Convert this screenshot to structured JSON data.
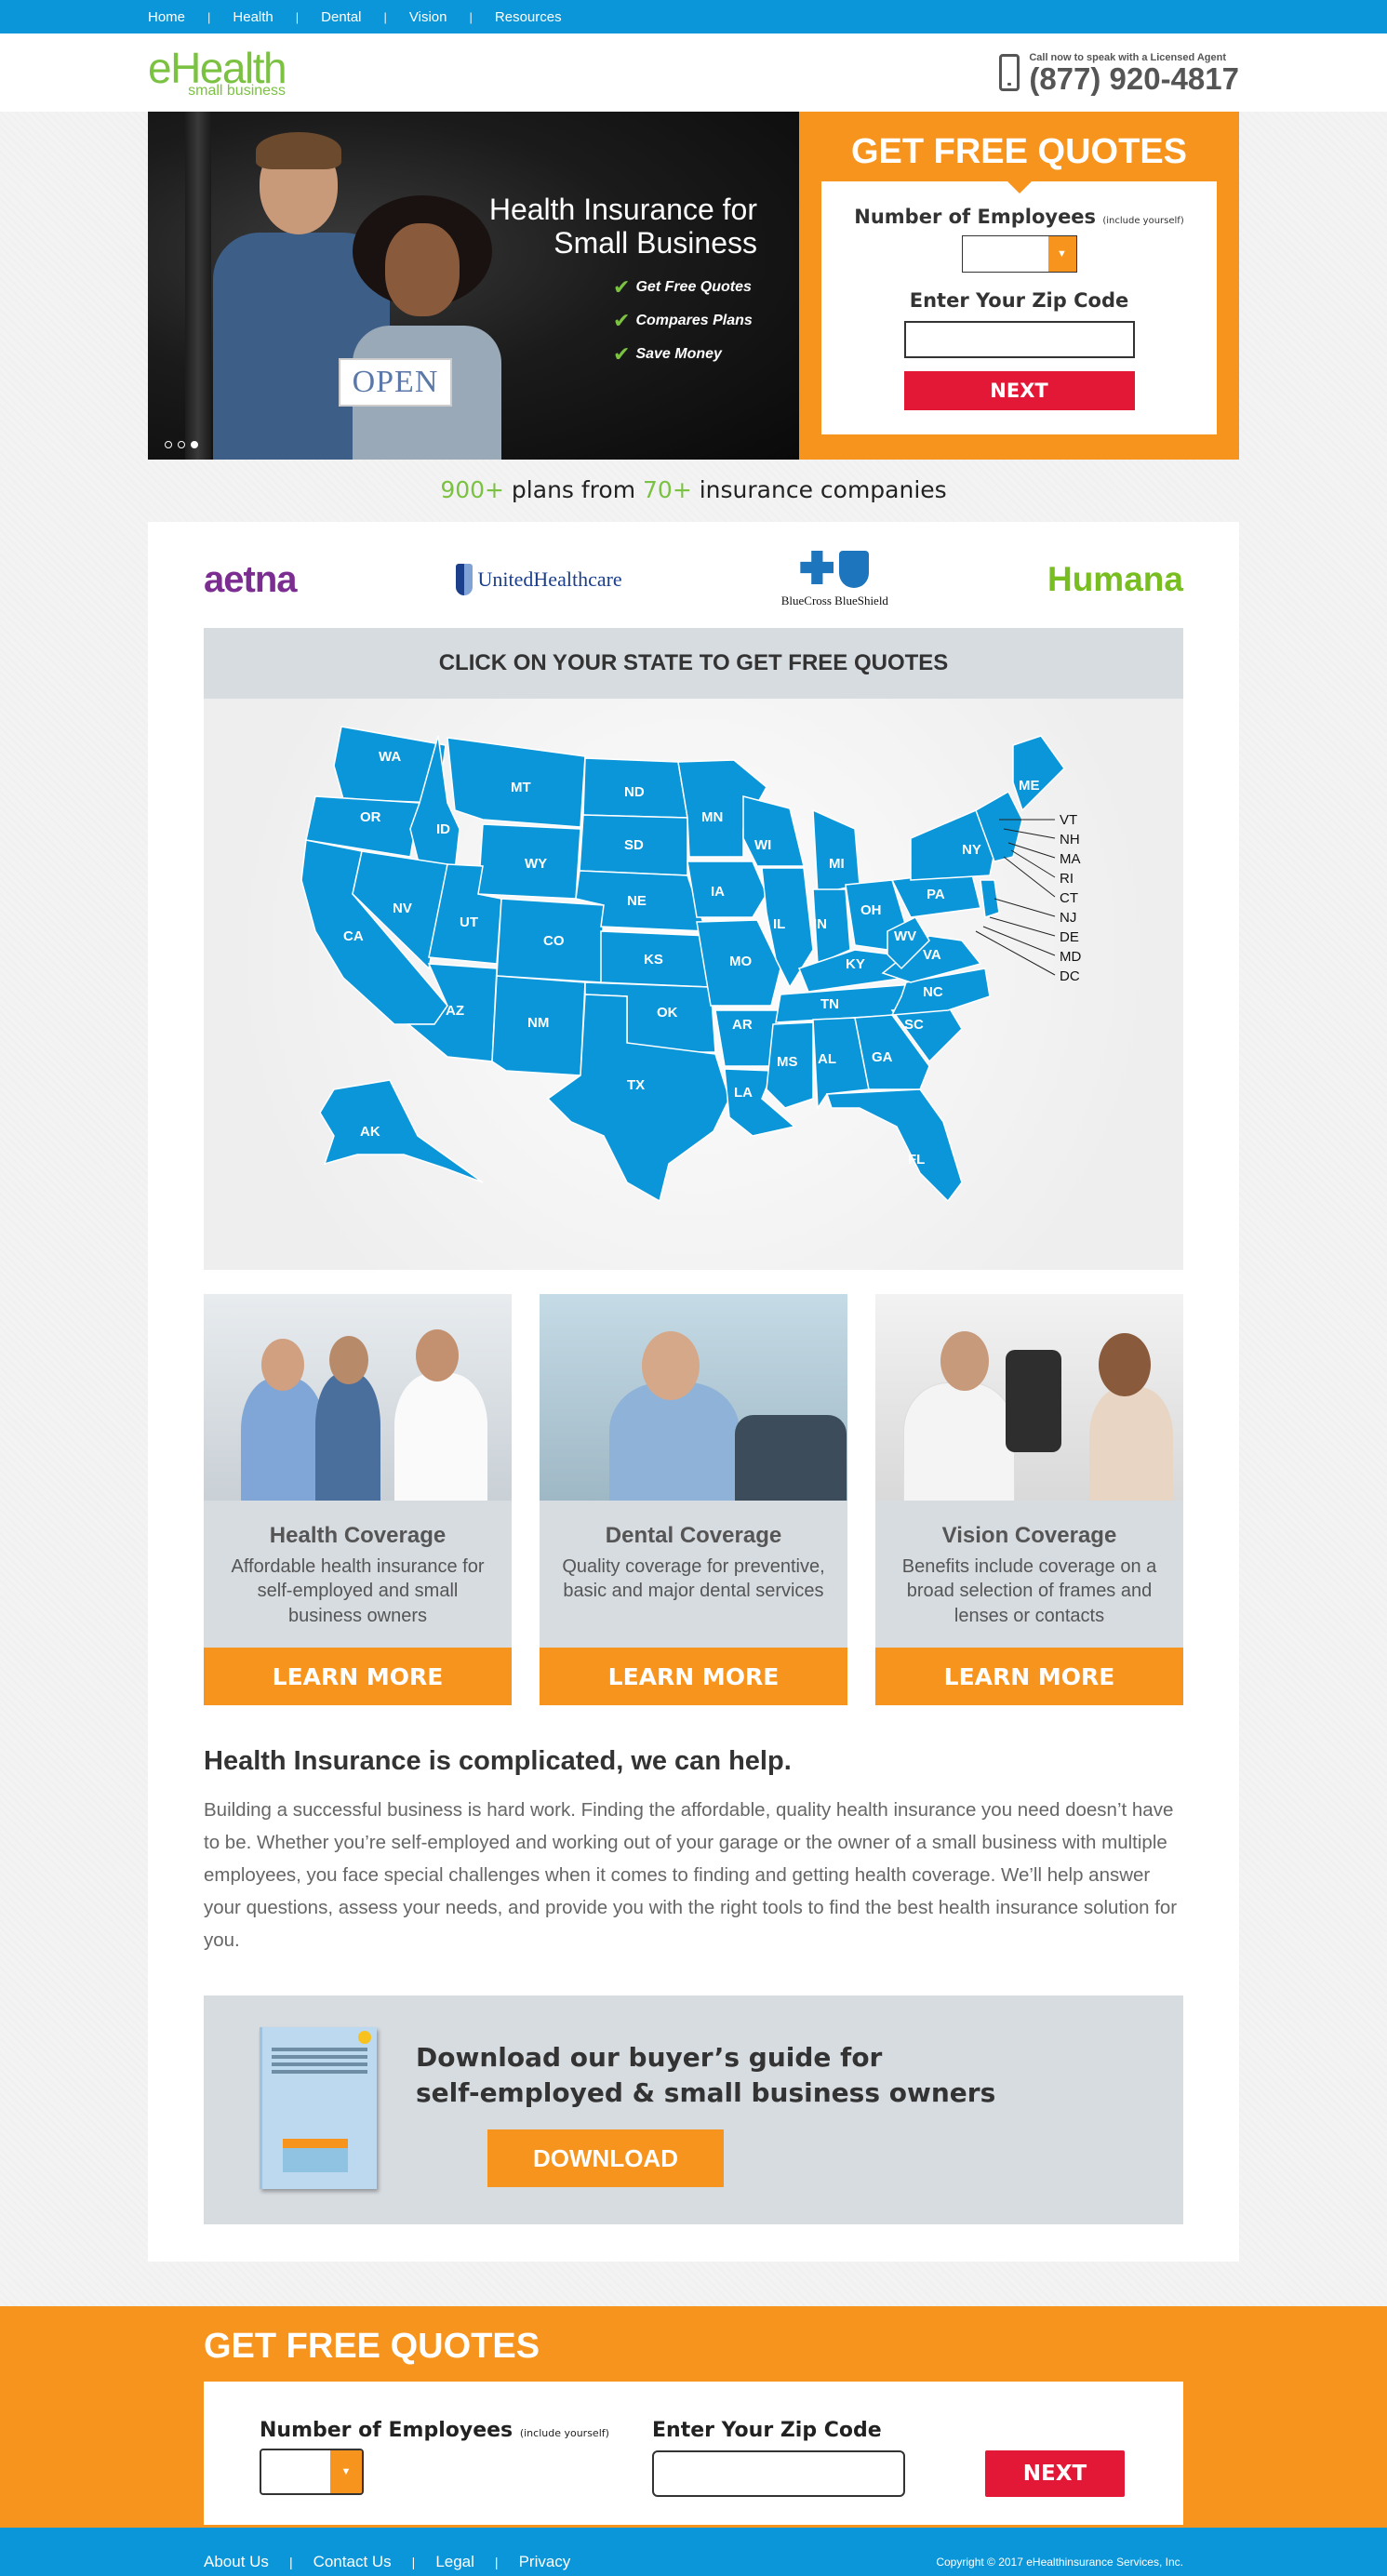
{
  "topnav": {
    "items": [
      "Home",
      "Health",
      "Dental",
      "Vision",
      "Resources"
    ]
  },
  "header": {
    "logo_main": "eHealth",
    "logo_sub": "small business",
    "phone_cta": "Call now to speak with a Licensed Agent",
    "phone_number": "(877) 920-4817"
  },
  "hero": {
    "headline_line1": "Health Insurance for",
    "headline_line2": "Small Business",
    "bullets": [
      "Get Free Quotes",
      "Compares Plans",
      "Save Money"
    ],
    "sign_text": "OPEN",
    "slide_count": 3,
    "active_slide": 3
  },
  "quote_form": {
    "title": "GET FREE QUOTES",
    "employees_label": "Number of Employees",
    "employees_note": "(include yourself)",
    "zip_label": "Enter Your Zip Code",
    "zip_value": "",
    "next_label": "NEXT"
  },
  "plans_line": {
    "plans_count": "900+",
    "plans_text": " plans from ",
    "companies_count": "70+",
    "companies_text": " insurance companies"
  },
  "carriers": {
    "aetna": "aetna",
    "uhc": "UnitedHealthcare",
    "bcbs": "BlueCross BlueShield",
    "humana": "Humana"
  },
  "state_section": {
    "heading": "CLICK ON YOUR STATE TO GET FREE QUOTES",
    "states": [
      "WA",
      "OR",
      "CA",
      "ID",
      "NV",
      "MT",
      "WY",
      "UT",
      "AZ",
      "CO",
      "NM",
      "ND",
      "SD",
      "NE",
      "KS",
      "OK",
      "TX",
      "MN",
      "IA",
      "MO",
      "AR",
      "LA",
      "WI",
      "IL",
      "MI",
      "IN",
      "OH",
      "KY",
      "TN",
      "MS",
      "AL",
      "GA",
      "FL",
      "SC",
      "NC",
      "VA",
      "WV",
      "PA",
      "NY",
      "ME",
      "AK"
    ],
    "callouts": [
      "VT",
      "NH",
      "MA",
      "RI",
      "CT",
      "NJ",
      "DE",
      "MD",
      "DC"
    ]
  },
  "coverage": [
    {
      "title": "Health Coverage",
      "text": "Affordable health insurance for self-employed and small business owners",
      "button": "LEARN MORE"
    },
    {
      "title": "Dental Coverage",
      "text": "Quality coverage for preventive, basic and major dental services",
      "button": "LEARN MORE"
    },
    {
      "title": "Vision Coverage",
      "text": "Benefits include coverage on a broad selection of frames and lenses or contacts",
      "button": "LEARN MORE"
    }
  ],
  "help": {
    "heading": "Health Insurance is complicated, we can help.",
    "body": "Building a successful business is hard work. Finding the affordable, quality health insurance you need doesn’t have to be. Whether you’re self-employed and working out of your garage or the owner of a small business with multiple employees, you face special challenges when it comes to finding and getting health coverage. We’ll help answer your questions, assess your needs, and provide you with the right tools to find the best health insurance solution for you."
  },
  "guide": {
    "line1": "Download our buyer’s guide for",
    "line2": "self-employed & small business owners",
    "button": "DOWNLOAD"
  },
  "bottom_quote": {
    "title": "GET FREE QUOTES",
    "employees_label": "Number of Employees",
    "employees_note": "(include yourself)",
    "zip_label": "Enter Your Zip Code",
    "next_label": "NEXT"
  },
  "footer": {
    "links": [
      "About Us",
      "Contact Us",
      "Legal",
      "Privacy"
    ],
    "copyright": "Copyright © 2017 eHealthinsurance Services, Inc."
  },
  "colors": {
    "brand_blue": "#0a96d8",
    "brand_green": "#7bc142",
    "orange": "#f7941d",
    "red": "#e31837",
    "map_blue": "#0a96d8"
  }
}
